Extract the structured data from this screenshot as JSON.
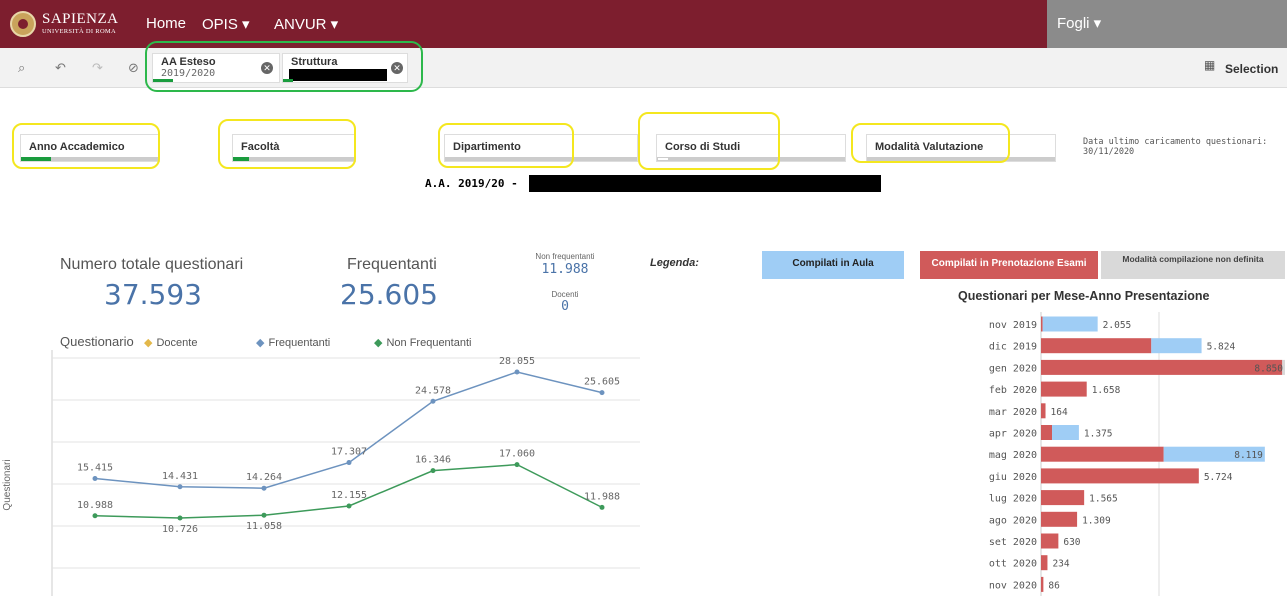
{
  "nav": {
    "logo_line1": "SAPIENZA",
    "logo_line2": "UNIVERSITÀ DI ROMA",
    "items": [
      "Home",
      "OPIS ▾",
      "ANVUR ▾"
    ],
    "fogli": "Fogli ▾"
  },
  "toolbar": {
    "selections_label": "Selection",
    "chips": [
      {
        "title": "AA Esteso",
        "value": "2019/2020"
      },
      {
        "title": "Struttura",
        "value": ""
      }
    ]
  },
  "filters": [
    "Anno Accademico",
    "Facoltà",
    "Dipartimento",
    "Corso di Studi",
    "Modalità Valutazione"
  ],
  "last_update": "Data ultimo caricamento questionari: 30/11/2020",
  "aa_heading": "A.A. 2019/20 -",
  "kpis": {
    "total_title": "Numero totale questionari",
    "total_value": "37.593",
    "freq_title": "Frequentanti",
    "freq_value": "25.605",
    "nonfreq_label": "Non frequentanti",
    "nonfreq_value": "11.988",
    "docenti_label": "Docenti",
    "docenti_value": "0"
  },
  "legend": {
    "label": "Legenda:",
    "aula": "Compilati in Aula",
    "prenotazione": "Compilati in Prenotazione Esami",
    "non_definita": "Modalità compilazione non definita"
  },
  "colors": {
    "nav": "#7d1e2e",
    "aula": "#9fcdf5",
    "prenotazione": "#d05a5a",
    "non_definita": "#d9d9d9",
    "frequentanti": "#6d93bf",
    "non_frequentanti": "#3d9a5a",
    "docente": "#e3b84a"
  },
  "chart_data": [
    {
      "type": "line",
      "title": "Questionario",
      "ylabel": "Questionari",
      "series": [
        {
          "name": "Docente",
          "values": []
        },
        {
          "name": "Frequentanti",
          "values": [
            15415,
            14431,
            14264,
            17307,
            24578,
            28055,
            25605
          ]
        },
        {
          "name": "Non Frequentanti",
          "values": [
            10988,
            10726,
            11058,
            12155,
            16346,
            17060,
            11988
          ]
        }
      ],
      "labels": {
        "Frequentanti": [
          "15.415",
          "14.431",
          "14.264",
          "17.307",
          "24.578",
          "28.055",
          "25.605"
        ],
        "Non Frequentanti": [
          "10.988",
          "10.726",
          "11.058",
          "12.155",
          "16.346",
          "17.060",
          "11.988"
        ]
      },
      "ylim": [
        0,
        33000
      ]
    },
    {
      "type": "bar",
      "title": "Questionari per Mese-Anno Presentazione",
      "categories": [
        "nov 2019",
        "dic 2019",
        "gen 2020",
        "feb 2020",
        "mar 2020",
        "apr 2020",
        "mag 2020",
        "giu 2020",
        "lug 2020",
        "ago 2020",
        "set 2020",
        "ott 2020",
        "nov 2020"
      ],
      "series": [
        {
          "name": "Compilati in Prenotazione Esami",
          "values": [
            60,
            4000,
            8750,
            1658,
            164,
            400,
            4450,
            5724,
            1565,
            1309,
            630,
            234,
            86
          ]
        },
        {
          "name": "Compilati in Aula",
          "values": [
            1995,
            1824,
            0,
            0,
            0,
            975,
            3669,
            0,
            0,
            0,
            0,
            0,
            0
          ]
        },
        {
          "name": "Modalità compilazione non definita",
          "values": [
            0,
            0,
            100,
            0,
            0,
            0,
            0,
            0,
            0,
            0,
            0,
            0,
            0
          ]
        }
      ],
      "labels": [
        "2.055",
        "5.824",
        "8.850",
        "1.658",
        "164",
        "1.375",
        "8.119",
        "5.724",
        "1.565",
        "1.309",
        "630",
        "234",
        "86"
      ],
      "xlim": [
        0,
        8850
      ]
    }
  ]
}
